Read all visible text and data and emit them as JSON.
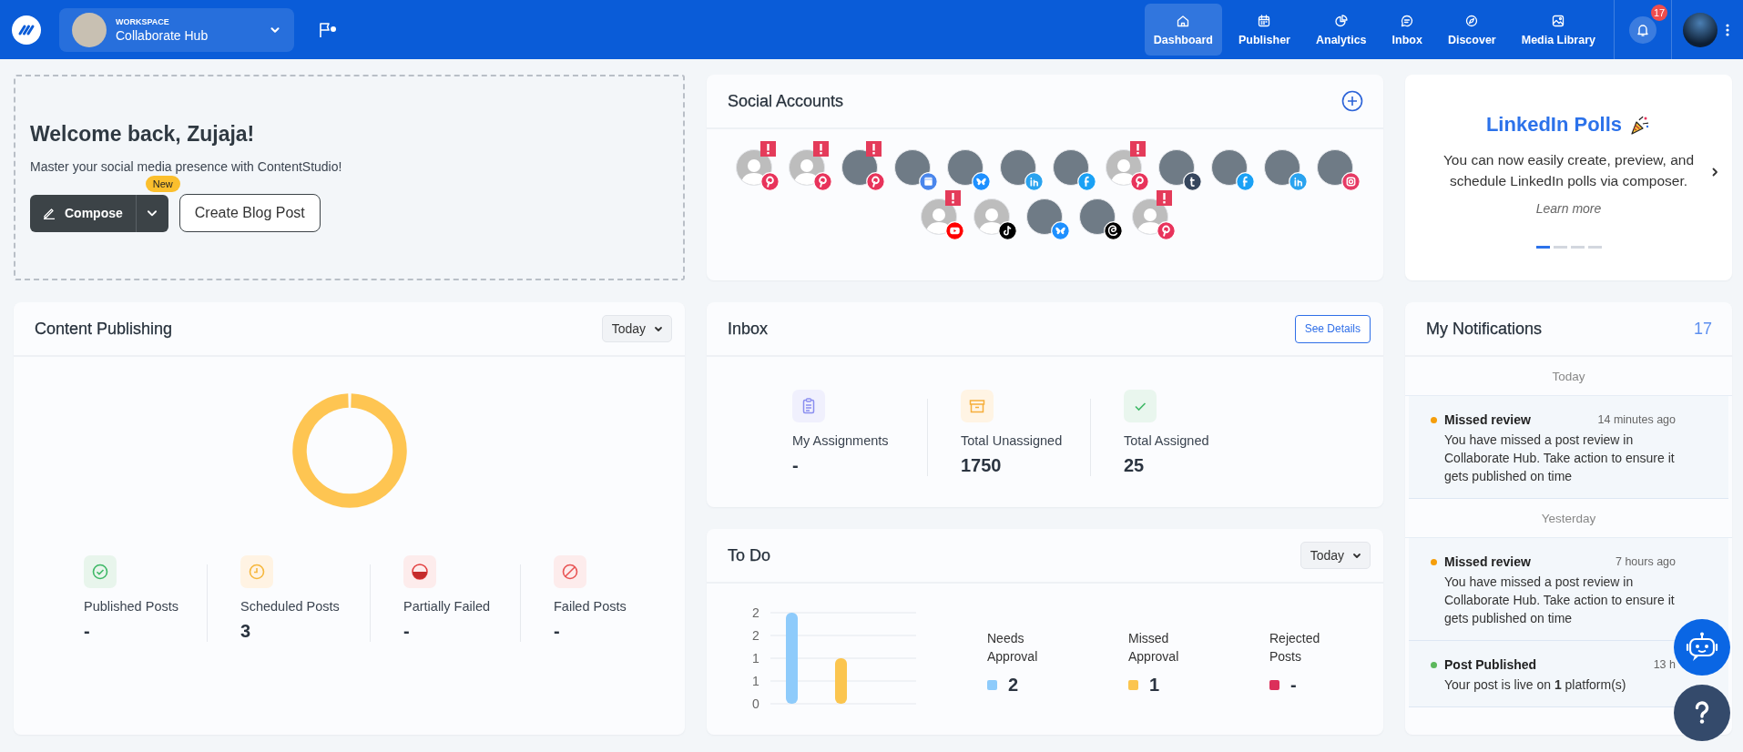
{
  "top_bar": {
    "workspace": {
      "label": "WORKSPACE",
      "name": "Collaborate Hub"
    },
    "nav": [
      {
        "label": "Dashboard",
        "selected": true
      },
      {
        "label": "Publisher",
        "selected": false
      },
      {
        "label": "Analytics",
        "selected": false
      },
      {
        "label": "Inbox",
        "selected": false
      },
      {
        "label": "Discover",
        "selected": false
      },
      {
        "label": "Media Library",
        "selected": false
      }
    ],
    "notification_count": "17"
  },
  "welcome": {
    "title": "Welcome back, Zujaja!",
    "subtitle": "Master your social media presence with ContentStudio!",
    "compose_button": "Compose",
    "new_badge": "New",
    "blog_button": "Create Blog Post"
  },
  "social_accounts": {
    "title": "Social Accounts",
    "accounts": [
      {
        "kind": "silhouette",
        "badge": {
          "kind": "pinterest"
        },
        "warning": true
      },
      {
        "kind": "silhouette",
        "badge": {
          "kind": "pinterest"
        },
        "warning": true
      },
      {
        "kind": "photo",
        "badge": {
          "kind": "pinterest"
        },
        "warning": true
      },
      {
        "kind": "photo",
        "badge": {
          "kind": "business"
        },
        "warning": false
      },
      {
        "kind": "photo",
        "badge": {
          "kind": "bluesky"
        },
        "warning": false
      },
      {
        "kind": "photo",
        "badge": {
          "kind": "linkedin"
        },
        "warning": false
      },
      {
        "kind": "photo",
        "badge": {
          "kind": "facebook"
        },
        "warning": false
      },
      {
        "kind": "silhouette",
        "badge": {
          "kind": "pinterest"
        },
        "warning": true
      },
      {
        "kind": "photo",
        "badge": {
          "kind": "tumblr"
        },
        "warning": false
      },
      {
        "kind": "photo",
        "badge": {
          "kind": "facebook"
        },
        "warning": false
      },
      {
        "kind": "photo",
        "badge": {
          "kind": "linkedin"
        },
        "warning": false
      },
      {
        "kind": "photo",
        "badge": {
          "kind": "instagram"
        },
        "warning": false
      },
      {
        "kind": "silhouette",
        "badge": {
          "kind": "youtube"
        },
        "warning": true
      },
      {
        "kind": "silhouette",
        "badge": {
          "kind": "tiktok"
        },
        "warning": false
      },
      {
        "kind": "photo",
        "badge": {
          "kind": "bluesky"
        },
        "warning": false
      },
      {
        "kind": "photo",
        "badge": {
          "kind": "threads"
        },
        "warning": false
      },
      {
        "kind": "silhouette",
        "badge": {
          "kind": "pinterest"
        },
        "warning": true
      }
    ]
  },
  "promo": {
    "title": "LinkedIn Polls",
    "body": "You can now easily create, preview, and schedule LinkedIn polls via composer.",
    "link": "Learn more",
    "slides": [
      {
        "selected": true
      },
      {
        "selected": false
      },
      {
        "selected": false
      },
      {
        "selected": false
      }
    ]
  },
  "content_publishing": {
    "title": "Content Publishing",
    "period": "Today",
    "stats": [
      {
        "label": "Published Posts",
        "value": "-"
      },
      {
        "label": "Scheduled Posts",
        "value": "3"
      },
      {
        "label": "Partially Failed",
        "value": "-"
      },
      {
        "label": "Failed Posts",
        "value": "-"
      }
    ]
  },
  "inbox": {
    "title": "Inbox",
    "button": "See Details",
    "stats": [
      {
        "label": "My Assignments",
        "value": "-"
      },
      {
        "label": "Total Unassigned",
        "value": "1750"
      },
      {
        "label": "Total Assigned",
        "value": "25"
      }
    ]
  },
  "todo": {
    "title": "To Do",
    "period": "Today",
    "chart_data": {
      "type": "bar",
      "grid": true,
      "values": [
        2,
        1,
        0
      ],
      "ylim": [
        0,
        2
      ],
      "yticks": [
        {
          "value": 0,
          "label": "0"
        },
        {
          "value": 0.5,
          "label": "1"
        },
        {
          "value": 1,
          "label": "1"
        },
        {
          "value": 1.5,
          "label": "2"
        },
        {
          "value": 2,
          "label": "2"
        }
      ]
    },
    "legend": [
      {
        "label": "Needs Approval",
        "value": "2",
        "color": "#8ecbfb"
      },
      {
        "label": "Missed Approval",
        "value": "1",
        "color": "#fbc54f"
      },
      {
        "label": "Rejected Posts",
        "value": "-",
        "color": "#dc2f5a"
      }
    ]
  },
  "my_notifications": {
    "title": "My Notifications",
    "count": "17",
    "groups": [
      {
        "label": "Today",
        "items": [
          {
            "title": "Missed review",
            "time": "14 minutes ago",
            "body": "You have missed a post review in Collaborate Hub. Take action to ensure it gets published on time",
            "color": "#f59e0b"
          }
        ]
      },
      {
        "label": "Yesterday",
        "items": [
          {
            "title": "Missed review",
            "time": "7 hours ago",
            "body": "You have missed a post review in Collaborate Hub. Take action to ensure it gets published on time",
            "color": "#f59e0b"
          },
          {
            "title": "Post Published",
            "time": "13 h",
            "body": "Your post is live on **1** platform(s)",
            "color": "#5cb85c"
          }
        ]
      }
    ]
  }
}
